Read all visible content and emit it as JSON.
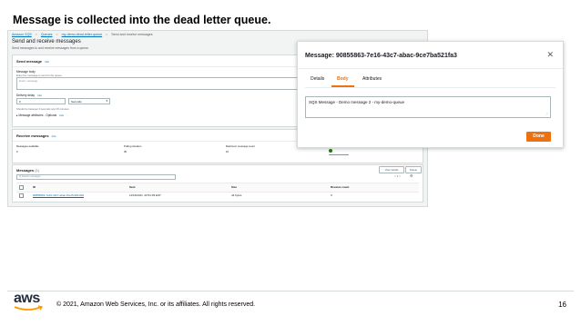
{
  "slide": {
    "title": "Message is collected into the dead letter queue.",
    "copyright": "© 2021, Amazon Web Services, Inc. or its affiliates. All rights reserved.",
    "page_number": "16",
    "logo_text": "aws"
  },
  "console": {
    "breadcrumbs": [
      "Amazon SQS",
      ">",
      "Queues",
      ">",
      "my-demo-dead-letter-queue",
      ">",
      "Send and receive messages"
    ],
    "page_title": "Send and receive messages",
    "page_subtitle": "Send messages to and receive messages from a queue.",
    "send": {
      "header": "Send message",
      "info": "Info",
      "body_label": "Message body",
      "body_hint": "Enter the message to send to the queue.",
      "body_placeholder": "Enter message",
      "delay_label": "Delivery delay",
      "delay_value": "0",
      "delay_unit": "Seconds",
      "delay_hint": "Should be between 0 seconds and 15 minutes.",
      "attributes": "Message attributes - Optional",
      "attributes_info": "Info"
    },
    "receive": {
      "header": "Receive messages",
      "info": "Info",
      "columns": [
        "Messages available",
        "Polling duration",
        "Maximum message count",
        "Polling progress"
      ],
      "values": [
        "0",
        "30",
        "10",
        ""
      ]
    },
    "messages": {
      "header": "Messages",
      "count": "(1)",
      "view_details": "View details",
      "delete": "Delete",
      "search_placeholder": "Q  Search messages",
      "pager": "< 1 >",
      "table_headers": [
        "ID",
        "Sent",
        "Size",
        "Receive count"
      ],
      "rows": [
        {
          "id": "90855863-7e16-43c7-abac-9ce7ba521fa3",
          "sent": "11/16/2021, 20:51:39 EST",
          "size": "44 bytes",
          "receive_count": "0"
        }
      ]
    }
  },
  "modal": {
    "title": "Message: 90855863-7e16-43c7-abac-9ce7ba521fa3",
    "tabs": [
      "Details",
      "Body",
      "Attributes"
    ],
    "active_tab": "Body",
    "body_text": "SQS Message - Demo message 2 - my-demo-queue",
    "done_label": "Done",
    "accent_color": "#ec7211"
  }
}
